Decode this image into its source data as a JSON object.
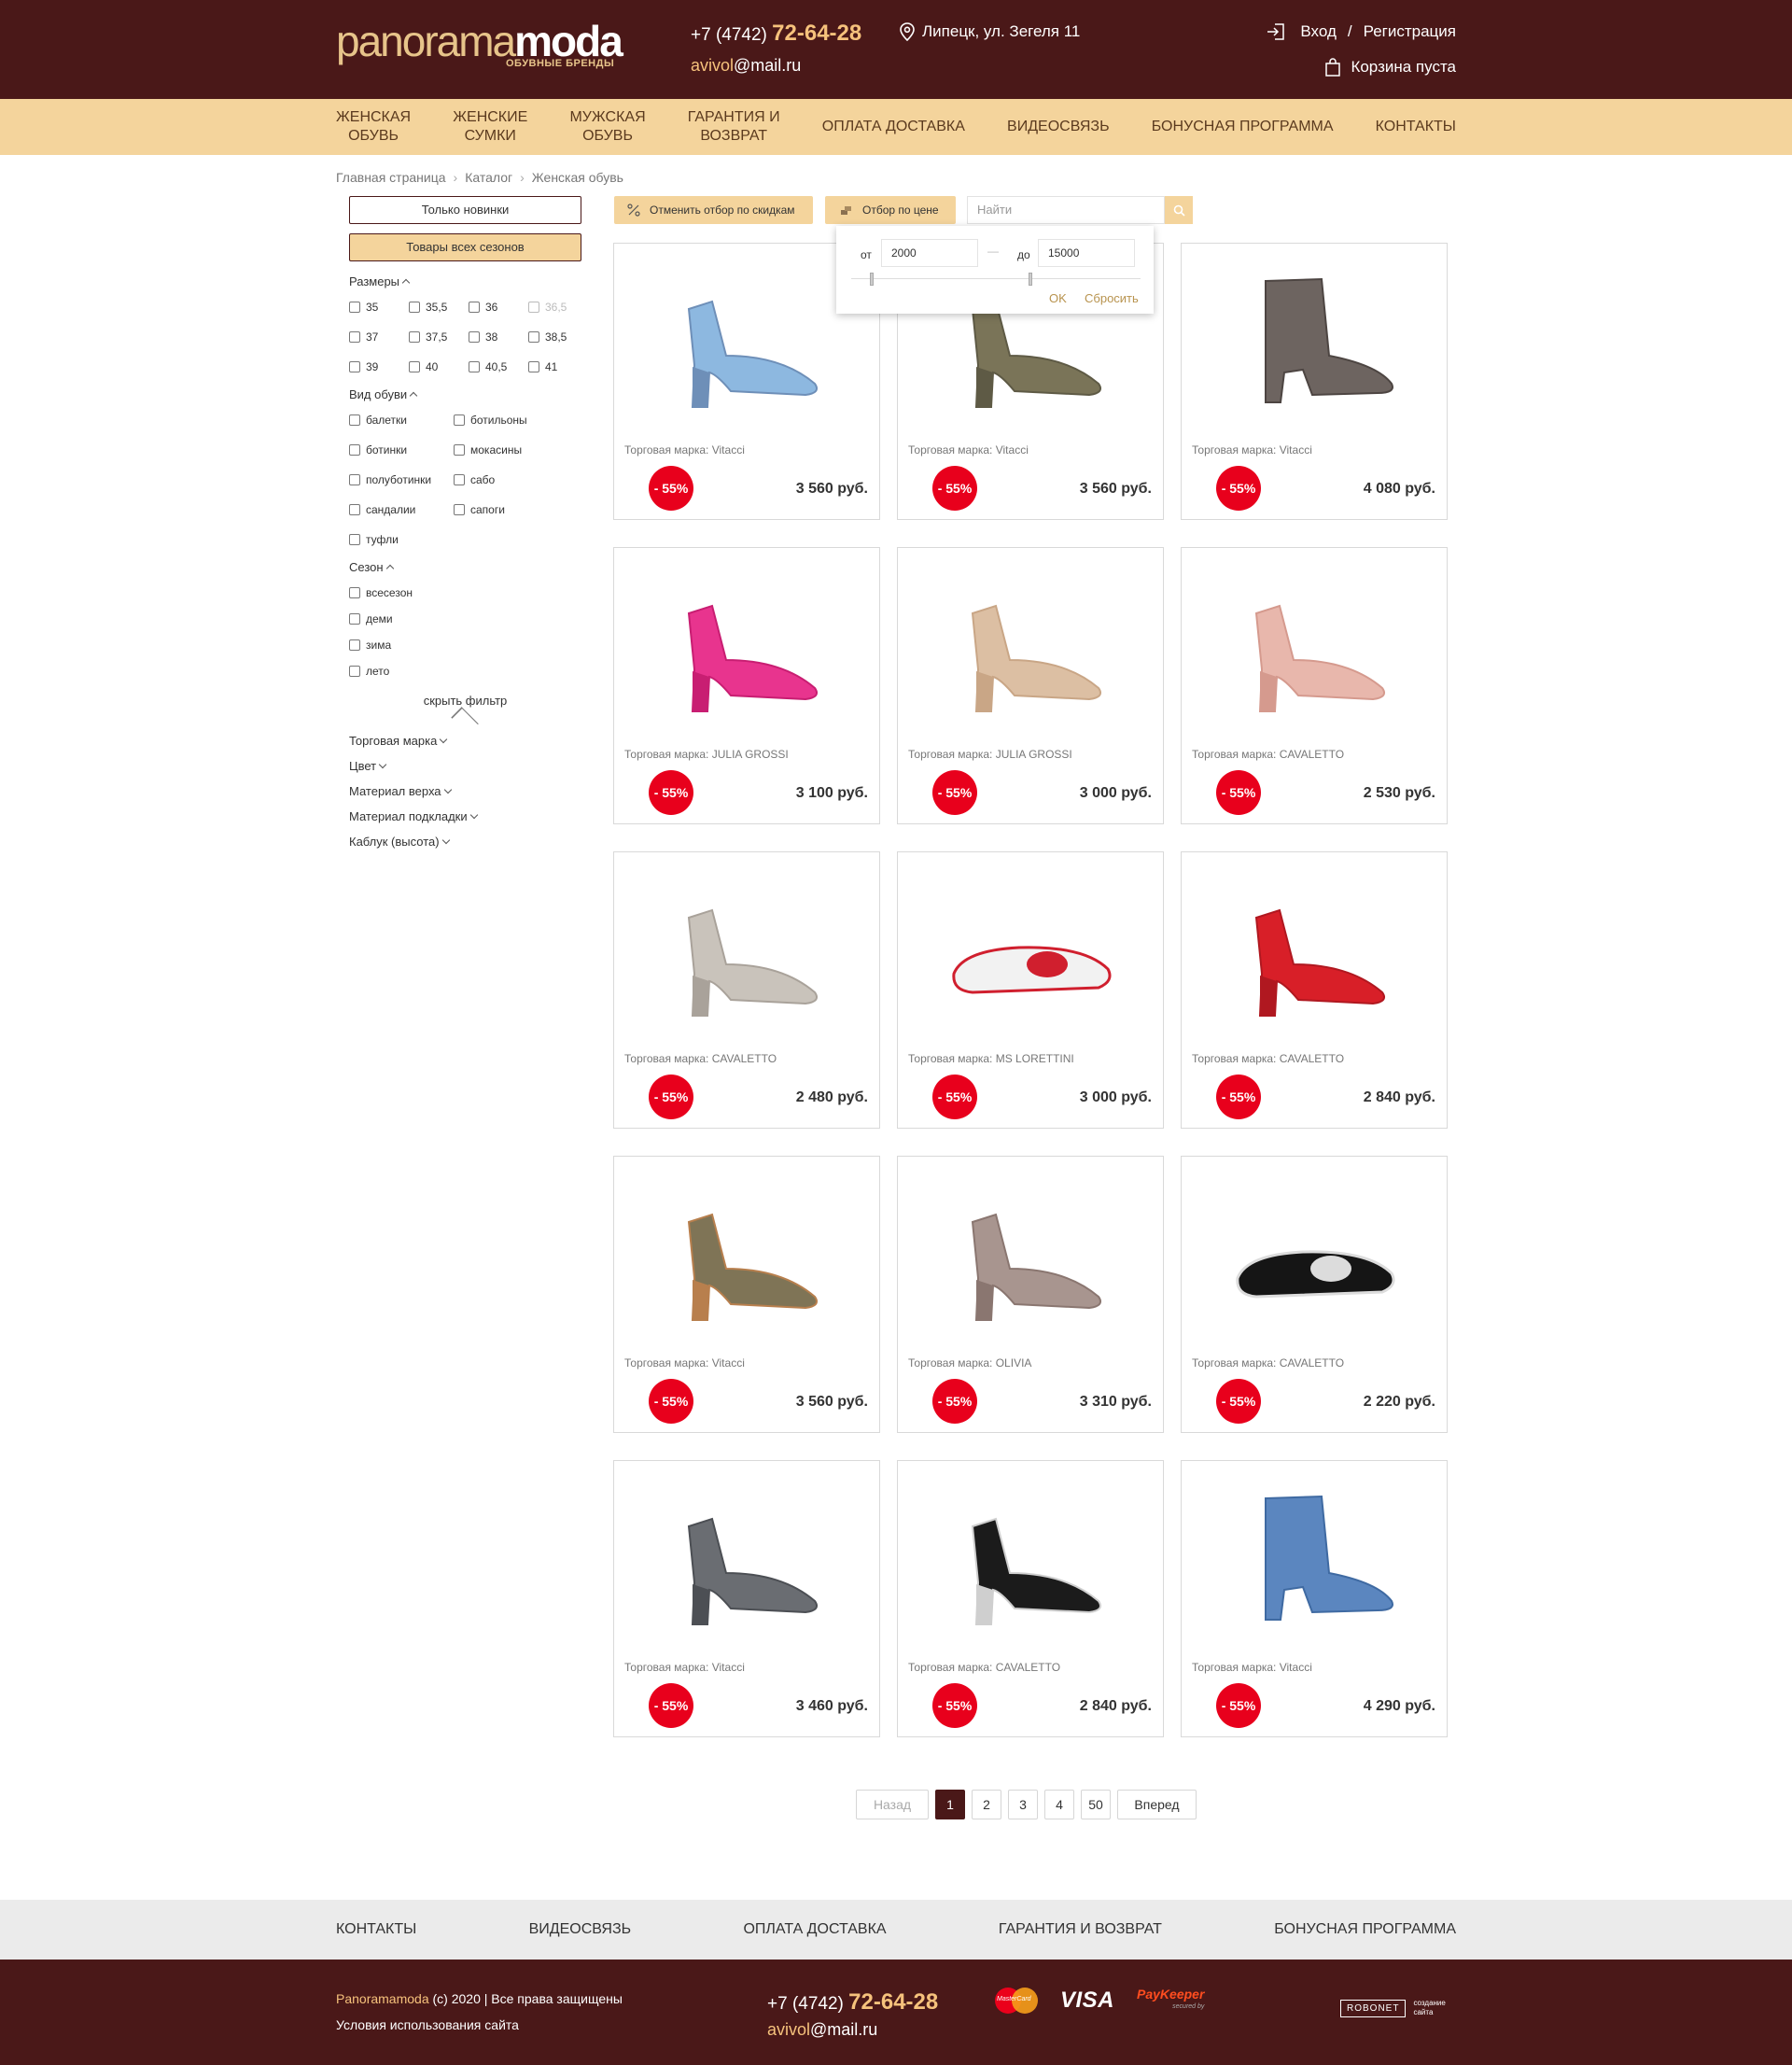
{
  "header": {
    "logo_part1": "panorama",
    "logo_part2": "moda",
    "logo_sub": "ОБУВНЫЕ БРЕНДЫ",
    "phone_code": "+7 (4742)",
    "phone_number": "72-64-28",
    "email_user": "avivol",
    "email_domain": "@mail.ru",
    "address": "Липецк, ул. Зегеля 11",
    "login": "Вход",
    "login_sep": "/",
    "register": "Регистрация",
    "cart": "Корзина пуста",
    "bg_color": "#4a1818",
    "accent": "#f6c27c"
  },
  "nav": {
    "items": [
      {
        "line1": "ЖЕНСКАЯ",
        "line2": "ОБУВЬ"
      },
      {
        "line1": "ЖЕНСКИЕ",
        "line2": "СУМКИ"
      },
      {
        "line1": "МУЖСКАЯ",
        "line2": "ОБУВЬ"
      },
      {
        "line1": "ГАРАНТИЯ И",
        "line2": "ВОЗВРАТ"
      },
      {
        "line1": "ОПЛАТА ДОСТАВКА",
        "line2": ""
      },
      {
        "line1": "ВИДЕОСВЯЗЬ",
        "line2": ""
      },
      {
        "line1": "БОНУСНАЯ ПРОГРАММА",
        "line2": ""
      },
      {
        "line1": "КОНТАКТЫ",
        "line2": ""
      }
    ],
    "bg_color": "#f4d49c"
  },
  "breadcrumb": [
    "Главная страница",
    "Каталог",
    "Женская обувь"
  ],
  "breadcrumb_sep": "›",
  "sidebar": {
    "btn_new": "Только новинки",
    "btn_all": "Товары всех сезонов",
    "sizes_title": "Размеры",
    "sizes": [
      {
        "label": "35",
        "disabled": false
      },
      {
        "label": "35,5",
        "disabled": false
      },
      {
        "label": "36",
        "disabled": false
      },
      {
        "label": "36,5",
        "disabled": true
      },
      {
        "label": "37",
        "disabled": false
      },
      {
        "label": "37,5",
        "disabled": false
      },
      {
        "label": "38",
        "disabled": false
      },
      {
        "label": "38,5",
        "disabled": false
      },
      {
        "label": "39",
        "disabled": false
      },
      {
        "label": "40",
        "disabled": false
      },
      {
        "label": "40,5",
        "disabled": false
      },
      {
        "label": "41",
        "disabled": false
      }
    ],
    "types_title": "Вид обуви",
    "types": [
      "балетки",
      "ботильоны",
      "ботинки",
      "мокасины",
      "полуботинки",
      "сабо",
      "сандалии",
      "сапоги",
      "туфли"
    ],
    "season_title": "Сезон",
    "seasons": [
      "всесезон",
      "деми",
      "зима",
      "лето"
    ],
    "hide_filter": "скрыть фильтр",
    "collapsed": [
      "Торговая марка",
      "Цвет",
      "Материал верха",
      "Материал подкладки",
      "Каблук (высота)"
    ]
  },
  "toolbar": {
    "discount_btn": "Отменить отбор по скидкам",
    "price_btn": "Отбор по цене",
    "search_placeholder": "Найти"
  },
  "price_filter": {
    "from_label": "от",
    "from_value": "2000",
    "dash": "—",
    "to_label": "до",
    "to_value": "15000",
    "ok": "OK",
    "reset": "Сбросить"
  },
  "brand_prefix": "Торговая марка: ",
  "products": [
    {
      "brand": "Vitacci",
      "discount": "- 55%",
      "price": "3 560 руб.",
      "shoe": "sandal-blue"
    },
    {
      "brand": "Vitacci",
      "discount": "- 55%",
      "price": "3 560 руб.",
      "shoe": "pump-olive"
    },
    {
      "brand": "Vitacci",
      "discount": "- 55%",
      "price": "4 080 руб.",
      "shoe": "bootie-grey"
    },
    {
      "brand": "JULIA GROSSI",
      "discount": "- 55%",
      "price": "3 100 руб.",
      "shoe": "slingback-pink"
    },
    {
      "brand": "JULIA GROSSI",
      "discount": "- 55%",
      "price": "3 000 руб.",
      "shoe": "pump-beige"
    },
    {
      "brand": "CAVALETTO",
      "discount": "- 55%",
      "price": "2 530 руб.",
      "shoe": "sandal-pink"
    },
    {
      "brand": "CAVALETTO",
      "discount": "- 55%",
      "price": "2 480 руб.",
      "shoe": "pump-silver"
    },
    {
      "brand": "MS LORETTINI",
      "discount": "- 55%",
      "price": "3 000 руб.",
      "shoe": "slide-rose"
    },
    {
      "brand": "CAVALETTO",
      "discount": "- 55%",
      "price": "2 840 руб.",
      "shoe": "mule-red"
    },
    {
      "brand": "Vitacci",
      "discount": "- 55%",
      "price": "3 560 руб.",
      "shoe": "sandal-olive"
    },
    {
      "brand": "OLIVIA",
      "discount": "- 55%",
      "price": "3 310 руб.",
      "shoe": "pump-mauve"
    },
    {
      "brand": "CAVALETTO",
      "discount": "- 55%",
      "price": "2 220 руб.",
      "shoe": "flat-black"
    },
    {
      "brand": "Vitacci",
      "discount": "- 55%",
      "price": "3 460 руб.",
      "shoe": "mule-grey"
    },
    {
      "brand": "CAVALETTO",
      "discount": "- 55%",
      "price": "2 840 руб.",
      "shoe": "platform-black"
    },
    {
      "brand": "Vitacci",
      "discount": "- 55%",
      "price": "4 290 руб.",
      "shoe": "bootie-blue"
    }
  ],
  "pagination": {
    "prev": "Назад",
    "pages": [
      "1",
      "2",
      "3",
      "4",
      "50"
    ],
    "active": "1",
    "next": "Вперед"
  },
  "footer_nav": [
    "КОНТАКТЫ",
    "ВИДЕОСВЯЗЬ",
    "ОПЛАТА ДОСТАВКА",
    "ГАРАНТИЯ И ВОЗВРАТ",
    "БОНУСНАЯ ПРОГРАММА"
  ],
  "footer": {
    "brand": "Panoramamoda",
    "copyright": " (c) 2020 | Все права защищены",
    "terms": "Условия использования сайта",
    "phone_code": "+7 (4742)",
    "phone_number": "72-64-28",
    "email_user": "avivol",
    "email_domain": "@mail.ru",
    "mastercard": "MasterCard",
    "visa": "VISA",
    "paykeeper": "PayKeeper",
    "paykeeper_sub": "secured by",
    "robonet": "ROBONET",
    "robonet_txt1": "создание",
    "robonet_txt2": "сайта"
  }
}
